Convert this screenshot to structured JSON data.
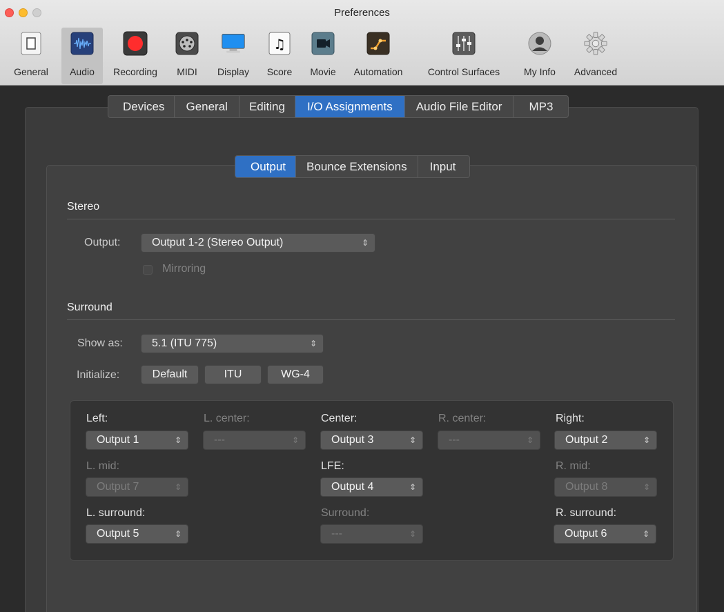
{
  "window": {
    "title": "Preferences"
  },
  "toolbar": {
    "items": [
      {
        "label": "General",
        "icon": "general-icon"
      },
      {
        "label": "Audio",
        "icon": "audio-icon"
      },
      {
        "label": "Recording",
        "icon": "recording-icon"
      },
      {
        "label": "MIDI",
        "icon": "midi-icon"
      },
      {
        "label": "Display",
        "icon": "display-icon"
      },
      {
        "label": "Score",
        "icon": "score-icon"
      },
      {
        "label": "Movie",
        "icon": "movie-icon"
      },
      {
        "label": "Automation",
        "icon": "automation-icon"
      },
      {
        "label": "Control Surfaces",
        "icon": "control-surfaces-icon"
      },
      {
        "label": "My Info",
        "icon": "my-info-icon"
      },
      {
        "label": "Advanced",
        "icon": "advanced-icon"
      }
    ],
    "selected": "Audio"
  },
  "tabs": [
    "Devices",
    "General",
    "Editing",
    "I/O Assignments",
    "Audio File Editor",
    "MP3"
  ],
  "active_tab": "I/O Assignments",
  "subtabs": [
    "Output",
    "Bounce Extensions",
    "Input"
  ],
  "active_subtab": "Output",
  "stereo": {
    "title": "Stereo",
    "output_label": "Output:",
    "output_value": "Output 1-2 (Stereo Output)",
    "mirroring_label": "Mirroring"
  },
  "surround": {
    "title": "Surround",
    "show_as_label": "Show as:",
    "show_as_value": "5.1 (ITU 775)",
    "initialize_label": "Initialize:",
    "buttons": [
      "Default",
      "ITU",
      "WG-4"
    ],
    "channels": {
      "left": {
        "label": "Left:",
        "value": "Output 1"
      },
      "l_center": {
        "label": "L. center:",
        "value": "---"
      },
      "center": {
        "label": "Center:",
        "value": "Output 3"
      },
      "r_center": {
        "label": "R. center:",
        "value": "---"
      },
      "right": {
        "label": "Right:",
        "value": "Output 2"
      },
      "l_mid": {
        "label": "L. mid:",
        "value": "Output 7"
      },
      "lfe": {
        "label": "LFE:",
        "value": "Output 4"
      },
      "r_mid": {
        "label": "R. mid:",
        "value": "Output 8"
      },
      "l_surround": {
        "label": "L. surround:",
        "value": "Output 5"
      },
      "surround": {
        "label": "Surround:",
        "value": "---"
      },
      "r_surround": {
        "label": "R. surround:",
        "value": "Output 6"
      }
    }
  },
  "colors": {
    "accent": "#2f70c4",
    "record": "#ff2d2d"
  }
}
